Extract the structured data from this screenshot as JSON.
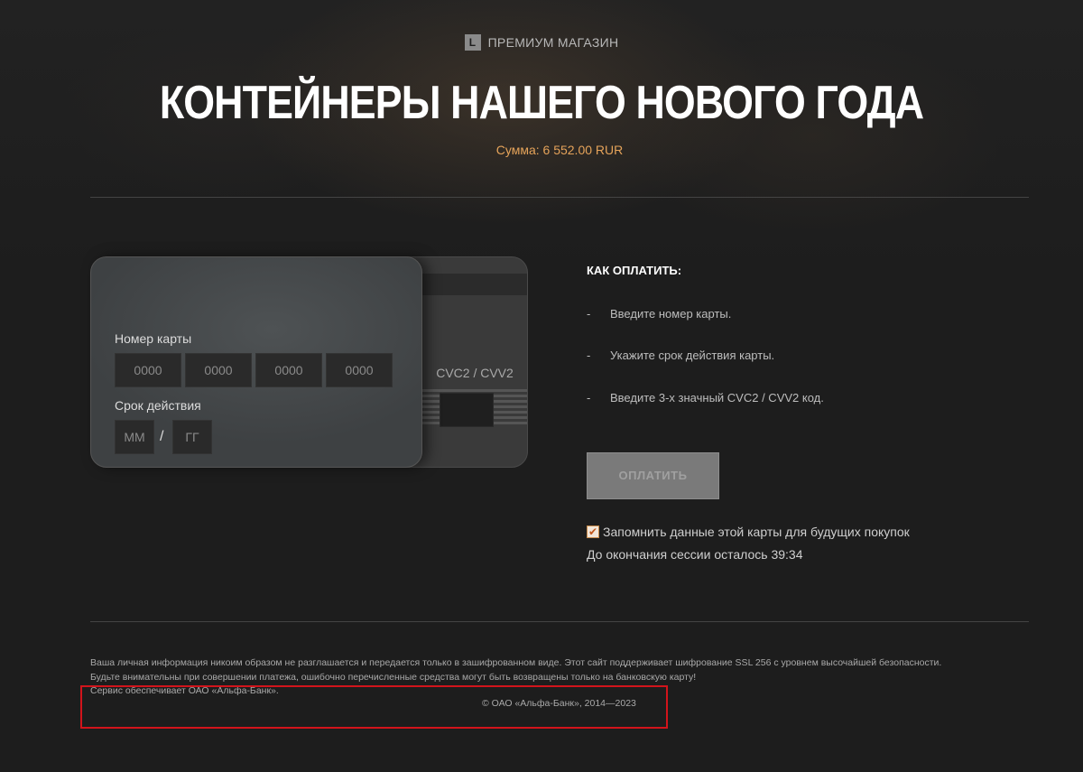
{
  "header": {
    "shop_logo": "L",
    "shop_label": "ПРЕМИУМ МАГАЗИН",
    "title": "КОНТЕЙНЕРЫ НАШЕГО НОВОГО ГОДА",
    "amount": "Сумма: 6 552.00 RUR"
  },
  "card_front": {
    "number_label": "Номер карты",
    "number_placeholders": [
      "0000",
      "0000",
      "0000",
      "0000"
    ],
    "expiry_label": "Срок действия",
    "month_placeholder": "ММ",
    "separator": "/",
    "year_placeholder": "ГГ"
  },
  "card_back": {
    "cvc_label": "CVC2 / CVV2"
  },
  "instructions": {
    "title": "КАК ОПЛАТИТЬ:",
    "dash": "-",
    "steps": [
      "Введите номер карты.",
      "Укажите срок действия карты.",
      "Введите 3-х значный CVC2 / CVV2 код."
    ]
  },
  "actions": {
    "pay_label": "ОПЛАТИТЬ",
    "remember_checked": true,
    "remember_label": "Запомнить данные этой карты для будущих покупок",
    "session_text": "До окончания сессии осталось 39:34"
  },
  "footer": {
    "line1": "Ваша личная информация никоим образом не разглашается и передается только в зашифрованном виде. Этот сайт поддерживает шифрование SSL 256 с уровнем высочайшей безопасности.",
    "line2": "Будьте внимательны при совершении платежа, ошибочно перечисленные средства могут быть возвращены только на банковскую карту!",
    "line3": "Сервис обеспечивает ОАО «Альфа-Банк».",
    "copyright": "© ОАО «Альфа-Банк», 2014—2023"
  },
  "colors": {
    "accent_amount": "#e5a35a",
    "highlight": "#d2141b"
  }
}
